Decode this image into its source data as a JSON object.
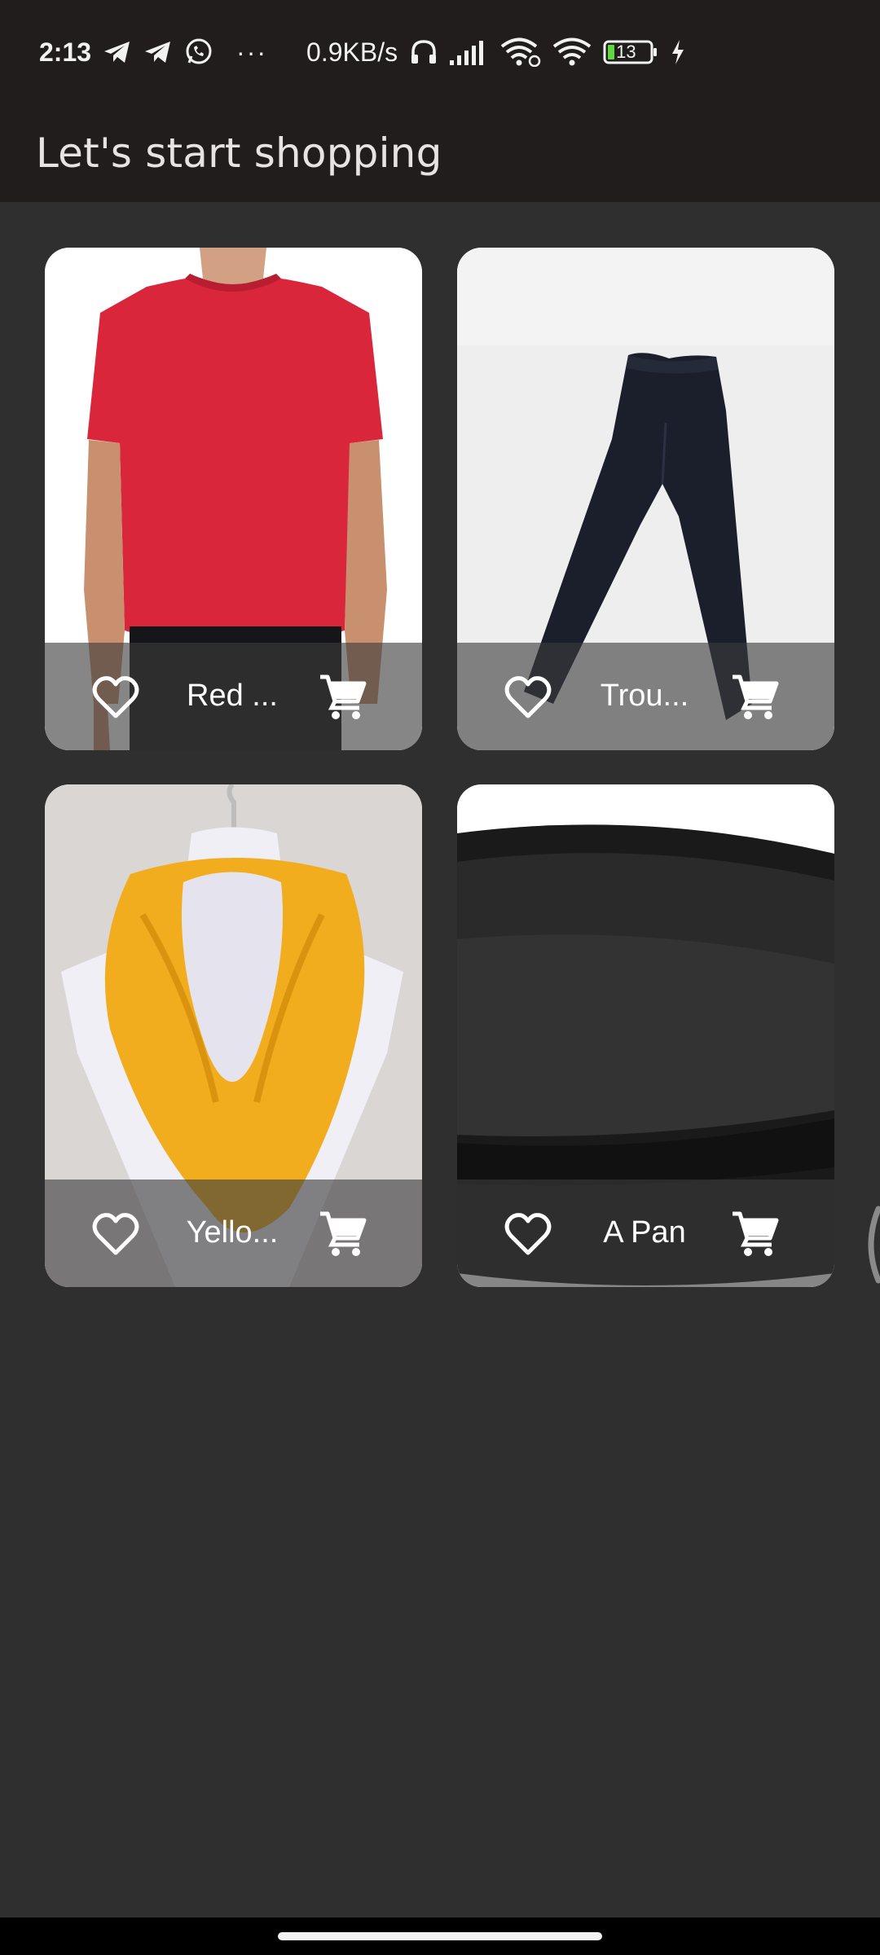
{
  "status_bar": {
    "time": "2:13",
    "more": "···",
    "net_speed": "0.9KB/s",
    "battery": "13"
  },
  "app_bar": {
    "title": "Let's start shopping"
  },
  "products": [
    {
      "name": "Red ...",
      "image": "red-tshirt",
      "favorite": false
    },
    {
      "name": "Trou...",
      "image": "navy-trousers",
      "favorite": false
    },
    {
      "name": "Yello...",
      "image": "yellow-scarf",
      "favorite": false
    },
    {
      "name": "A Pan",
      "image": "cast-iron-pan",
      "favorite": false
    }
  ],
  "colors": {
    "background": "#2f2f2f",
    "app_bar": "#211d1d",
    "card_footer_overlay": "rgba(60,60,60,0.62)",
    "battery_fill": "#5fd83f"
  }
}
